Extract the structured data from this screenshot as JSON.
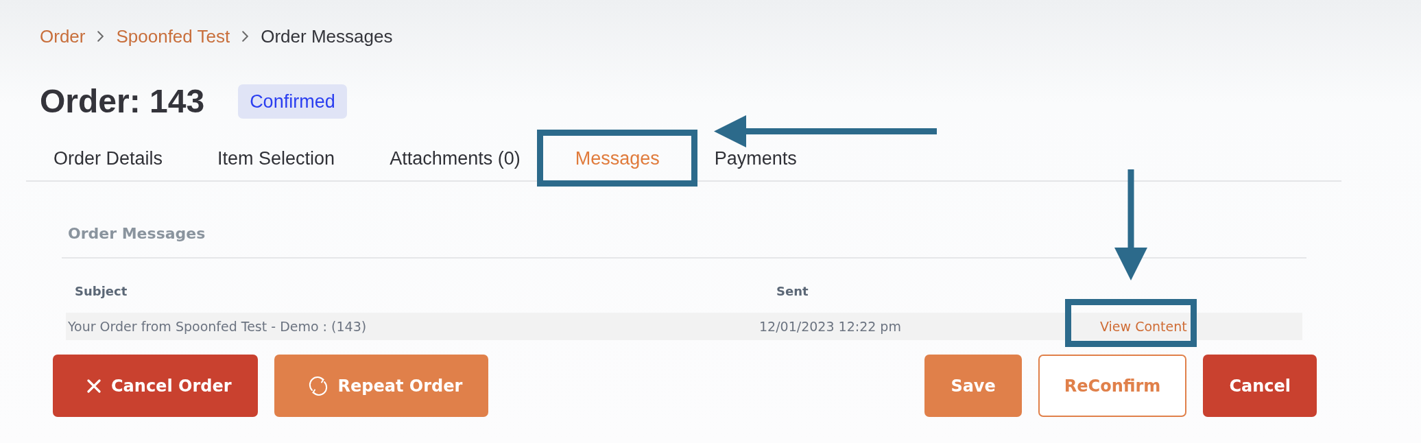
{
  "breadcrumb": [
    {
      "label": "Order",
      "kind": "link"
    },
    {
      "label": "Spoonfed Test",
      "kind": "link"
    },
    {
      "label": "Order Messages",
      "kind": "current"
    }
  ],
  "order": {
    "title": "Order: 143",
    "status": "Confirmed"
  },
  "tabs": [
    {
      "label": "Order Details",
      "selected": false,
      "highlighted": false
    },
    {
      "label": "Item Selection",
      "selected": false,
      "highlighted": false
    },
    {
      "label": "Attachments (0)",
      "selected": false,
      "highlighted": false
    },
    {
      "label": "Messages",
      "selected": true,
      "highlighted": true
    },
    {
      "label": "Payments",
      "selected": false,
      "highlighted": false
    }
  ],
  "messages": {
    "title": "Order Messages",
    "columns": [
      "Subject",
      "Sent"
    ],
    "rows": [
      {
        "subject": "Your Order from Spoonfed Test - Demo : (143)",
        "sent": "12/01/2023 12:22 pm",
        "action": "View Content",
        "action_highlighted": true
      }
    ]
  },
  "footer_buttons": {
    "left": [
      {
        "label": "Cancel Order",
        "kind": "danger"
      },
      {
        "label": "Repeat Order",
        "kind": "primary"
      }
    ],
    "right": [
      {
        "label": "Save",
        "kind": "primary"
      },
      {
        "label": "ReConfirm",
        "kind": "outline"
      },
      {
        "label": "Cancel",
        "kind": "danger"
      }
    ]
  }
}
